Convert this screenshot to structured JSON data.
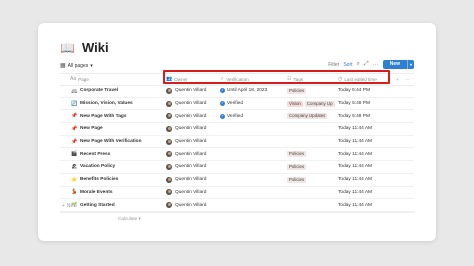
{
  "page": {
    "title": "Wiki",
    "title_icon": "book-icon"
  },
  "view": {
    "label": "All pages",
    "chevron": "▾"
  },
  "toolbar": {
    "filter": "Filter",
    "sort": "Sort",
    "search_icon": "⌕",
    "expand_icon": "⤢",
    "more_icon": "···",
    "new_label": "New",
    "new_caret": "▾"
  },
  "columns": {
    "page": "Page",
    "owner": "Owner",
    "verification": "Verification",
    "tags": "Tags",
    "last_edited": "Last edited time",
    "add_icon": "+",
    "more_icon": "···"
  },
  "rows": [
    {
      "emoji": "🚐",
      "name": "Corporate Travel",
      "owner": "Quentin Villard",
      "verification": "Until April 18, 2023",
      "verified": true,
      "tags": [
        "Policies"
      ],
      "edited": "Today 5:44 PM"
    },
    {
      "emoji": "🔄",
      "name": "Mission, Vision, Values",
      "owner": "Quentin Villard",
      "verification": "Verified",
      "verified": true,
      "tags": [
        "Vision",
        "Company Up"
      ],
      "edited": "Today 5:48 PM"
    },
    {
      "emoji": "📌",
      "name": "New Page With Tags",
      "owner": "Quentin Villard",
      "verification": "Verified",
      "verified": true,
      "tags": [
        "Company Updates"
      ],
      "edited": "Today 5:48 PM"
    },
    {
      "emoji": "📌",
      "name": "New Page",
      "owner": "Quentin Villard",
      "verification": "",
      "verified": false,
      "tags": [],
      "edited": "Today 11:44 AM"
    },
    {
      "emoji": "📌",
      "name": "New Page With Verification",
      "owner": "Quentin Villard",
      "verification": "",
      "verified": false,
      "tags": [],
      "edited": "Today 11:44 AM"
    },
    {
      "emoji": "🎬",
      "name": "Recent Press",
      "owner": "Quentin Villard",
      "verification": "",
      "verified": false,
      "tags": [
        "Policies"
      ],
      "edited": "Today 11:44 AM"
    },
    {
      "emoji": "🏖",
      "name": "Vacation Policy",
      "owner": "Quentin Villard",
      "verification": "",
      "verified": false,
      "tags": [
        "Policies"
      ],
      "edited": "Today 11:44 AM"
    },
    {
      "emoji": "⭐",
      "name": "Benefits Policies",
      "owner": "Quentin Villard",
      "verification": "",
      "verified": false,
      "tags": [
        "Policies"
      ],
      "edited": "Today 11:44 AM"
    },
    {
      "emoji": "💃",
      "name": "Morale Events",
      "owner": "Quentin Villard",
      "verification": "",
      "verified": false,
      "tags": [],
      "edited": "Today 11:44 AM"
    },
    {
      "emoji": "🌱",
      "name": "Getting Started",
      "owner": "Quentin Villard",
      "verification": "",
      "verified": false,
      "tags": [],
      "edited": "Today 11:44 AM"
    }
  ],
  "footer": {
    "new_row": "New",
    "calculate": "Calculate"
  },
  "colors": {
    "accent": "#2f80d1",
    "highlight": "#d81b1b",
    "tag_bg": "#f3e4e4"
  }
}
